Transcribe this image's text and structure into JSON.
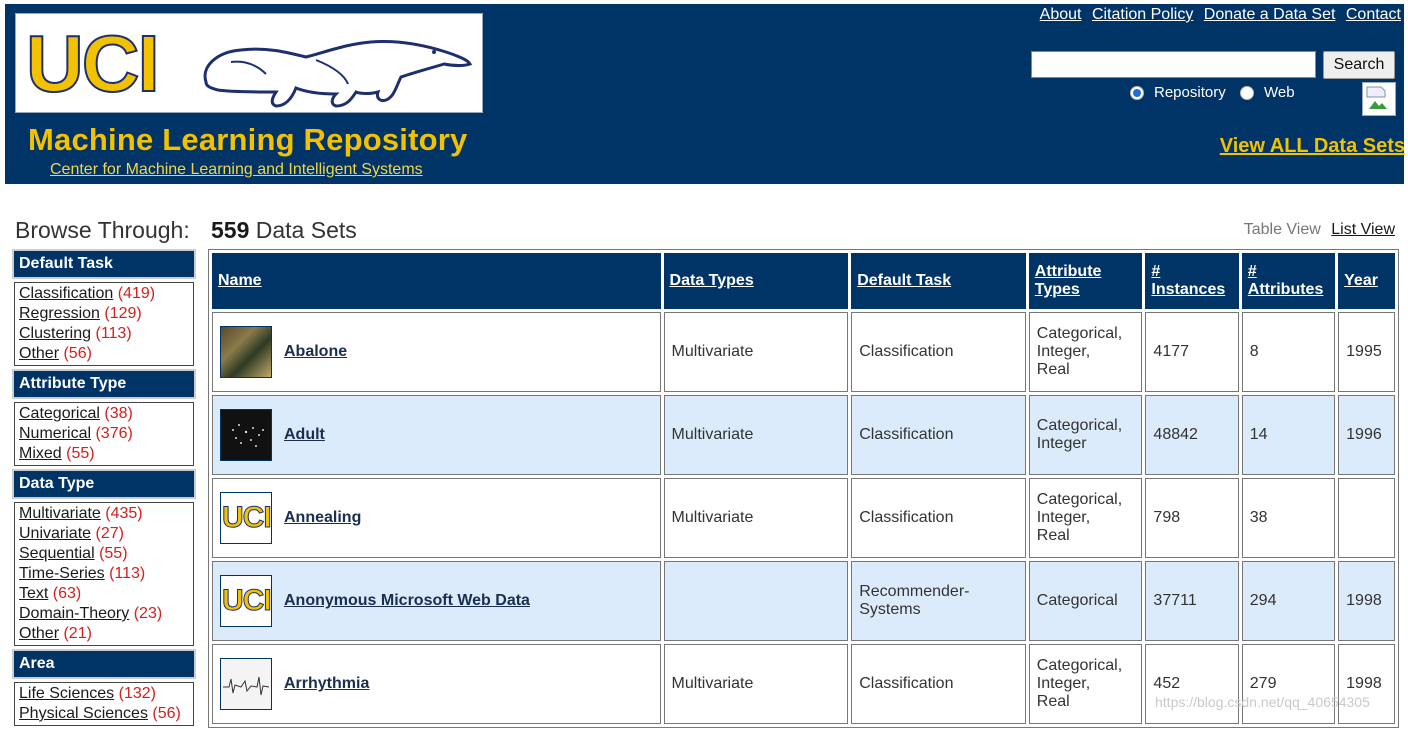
{
  "header": {
    "logo_text": "UCI",
    "site_title": "Machine Learning Repository",
    "center_link": "Center for Machine Learning and Intelligent Systems",
    "top_links": [
      "About",
      "Citation Policy",
      "Donate a Data Set",
      "Contact"
    ],
    "search_button": "Search",
    "search_value": "",
    "radio_repository": "Repository",
    "radio_web": "Web",
    "radio_selected": "Repository",
    "view_all": "View ALL Data Sets"
  },
  "browse": {
    "label": "Browse Through:",
    "count": "559",
    "count_suffix": "Data Sets",
    "table_view": "Table View",
    "list_view": "List View"
  },
  "sidebar": {
    "default_task": {
      "title": "Default Task",
      "items": [
        {
          "label": "Classification",
          "count": "(419)"
        },
        {
          "label": "Regression",
          "count": "(129)"
        },
        {
          "label": "Clustering",
          "count": "(113)"
        },
        {
          "label": "Other",
          "count": "(56)"
        }
      ]
    },
    "attribute_type": {
      "title": "Attribute Type",
      "items": [
        {
          "label": "Categorical",
          "count": "(38)"
        },
        {
          "label": "Numerical",
          "count": "(376)"
        },
        {
          "label": "Mixed",
          "count": "(55)"
        }
      ]
    },
    "data_type": {
      "title": "Data Type",
      "items": [
        {
          "label": "Multivariate",
          "count": "(435)"
        },
        {
          "label": "Univariate",
          "count": "(27)"
        },
        {
          "label": "Sequential",
          "count": "(55)"
        },
        {
          "label": "Time-Series",
          "count": "(113)"
        },
        {
          "label": "Text",
          "count": "(63)"
        },
        {
          "label": "Domain-Theory",
          "count": "(23)"
        },
        {
          "label": "Other",
          "count": "(21)"
        }
      ]
    },
    "area": {
      "title": "Area",
      "items": [
        {
          "label": "Life Sciences",
          "count": "(132)"
        },
        {
          "label": "Physical Sciences",
          "count": "(56)"
        }
      ]
    }
  },
  "table": {
    "headers": {
      "name": "Name",
      "data_types": "Data Types",
      "default_task": "Default Task",
      "attribute_types_1": "Attribute",
      "attribute_types_2": "Types",
      "instances_1": "#",
      "instances_2": "Instances",
      "attributes_1": "#",
      "attributes_2": "Attributes",
      "year": "Year"
    },
    "rows": [
      {
        "name": "Abalone",
        "data_types": "Multivariate",
        "task": "Classification",
        "attr": [
          "Categorical,",
          "Integer,",
          "Real"
        ],
        "instances": "4177",
        "attributes": "8",
        "year": "1995",
        "thumb": "abalone-image"
      },
      {
        "name": "Adult",
        "data_types": "Multivariate",
        "task": "Classification",
        "attr": [
          "Categorical,",
          "Integer"
        ],
        "instances": "48842",
        "attributes": "14",
        "year": "1996",
        "thumb": "adult-image"
      },
      {
        "name": "Annealing",
        "data_types": "Multivariate",
        "task": "Classification",
        "attr": [
          "Categorical,",
          "Integer,",
          "Real"
        ],
        "instances": "798",
        "attributes": "38",
        "year": "",
        "thumb": "uci-logo"
      },
      {
        "name": "Anonymous Microsoft Web Data",
        "data_types": "",
        "task": "Recommender-\nSystems",
        "attr": [
          "Categorical"
        ],
        "instances": "37711",
        "attributes": "294",
        "year": "1998",
        "thumb": "uci-logo"
      },
      {
        "name": "Arrhythmia",
        "data_types": "Multivariate",
        "task": "Classification",
        "attr": [
          "Categorical,",
          "Integer,",
          "Real"
        ],
        "instances": "452",
        "attributes": "279",
        "year": "1998",
        "thumb": "arrhythmia-image"
      }
    ]
  },
  "watermark": "https://blog.csdn.net/qq_40654305"
}
